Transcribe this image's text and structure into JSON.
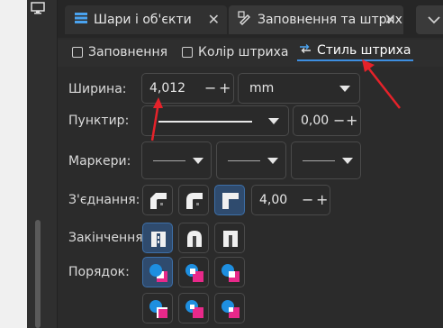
{
  "tabs": [
    {
      "label": "Шари і об'єкти",
      "close": "✕",
      "icon": "layers-icon"
    },
    {
      "label": "Заповнення та штрих",
      "close": "✕",
      "icon": "fill-stroke-icon"
    }
  ],
  "subtabs": [
    {
      "label": "Заповнення",
      "icon": "checkbox-icon"
    },
    {
      "label": "Колір штриха",
      "icon": "checkbox-icon"
    },
    {
      "label": "Стиль штриха",
      "icon": "stroke-style-icon"
    }
  ],
  "width": {
    "label": "Ширина:",
    "value": "4,012",
    "unit": "mm"
  },
  "dash": {
    "label": "Пунктир:",
    "offset": "0,00"
  },
  "markers": {
    "label": "Маркери:"
  },
  "join": {
    "label": "З'єднання:",
    "miter": "4,00"
  },
  "caps": {
    "label": "Закінчення:"
  },
  "order": {
    "label": "Порядок:"
  },
  "controls": {
    "minus": "−",
    "plus": "+"
  },
  "colors": {
    "accent": "#3d8ee0",
    "annotation": "#e5222a",
    "marker_pink": "#e8298a",
    "marker_blue": "#1e8fe0"
  }
}
